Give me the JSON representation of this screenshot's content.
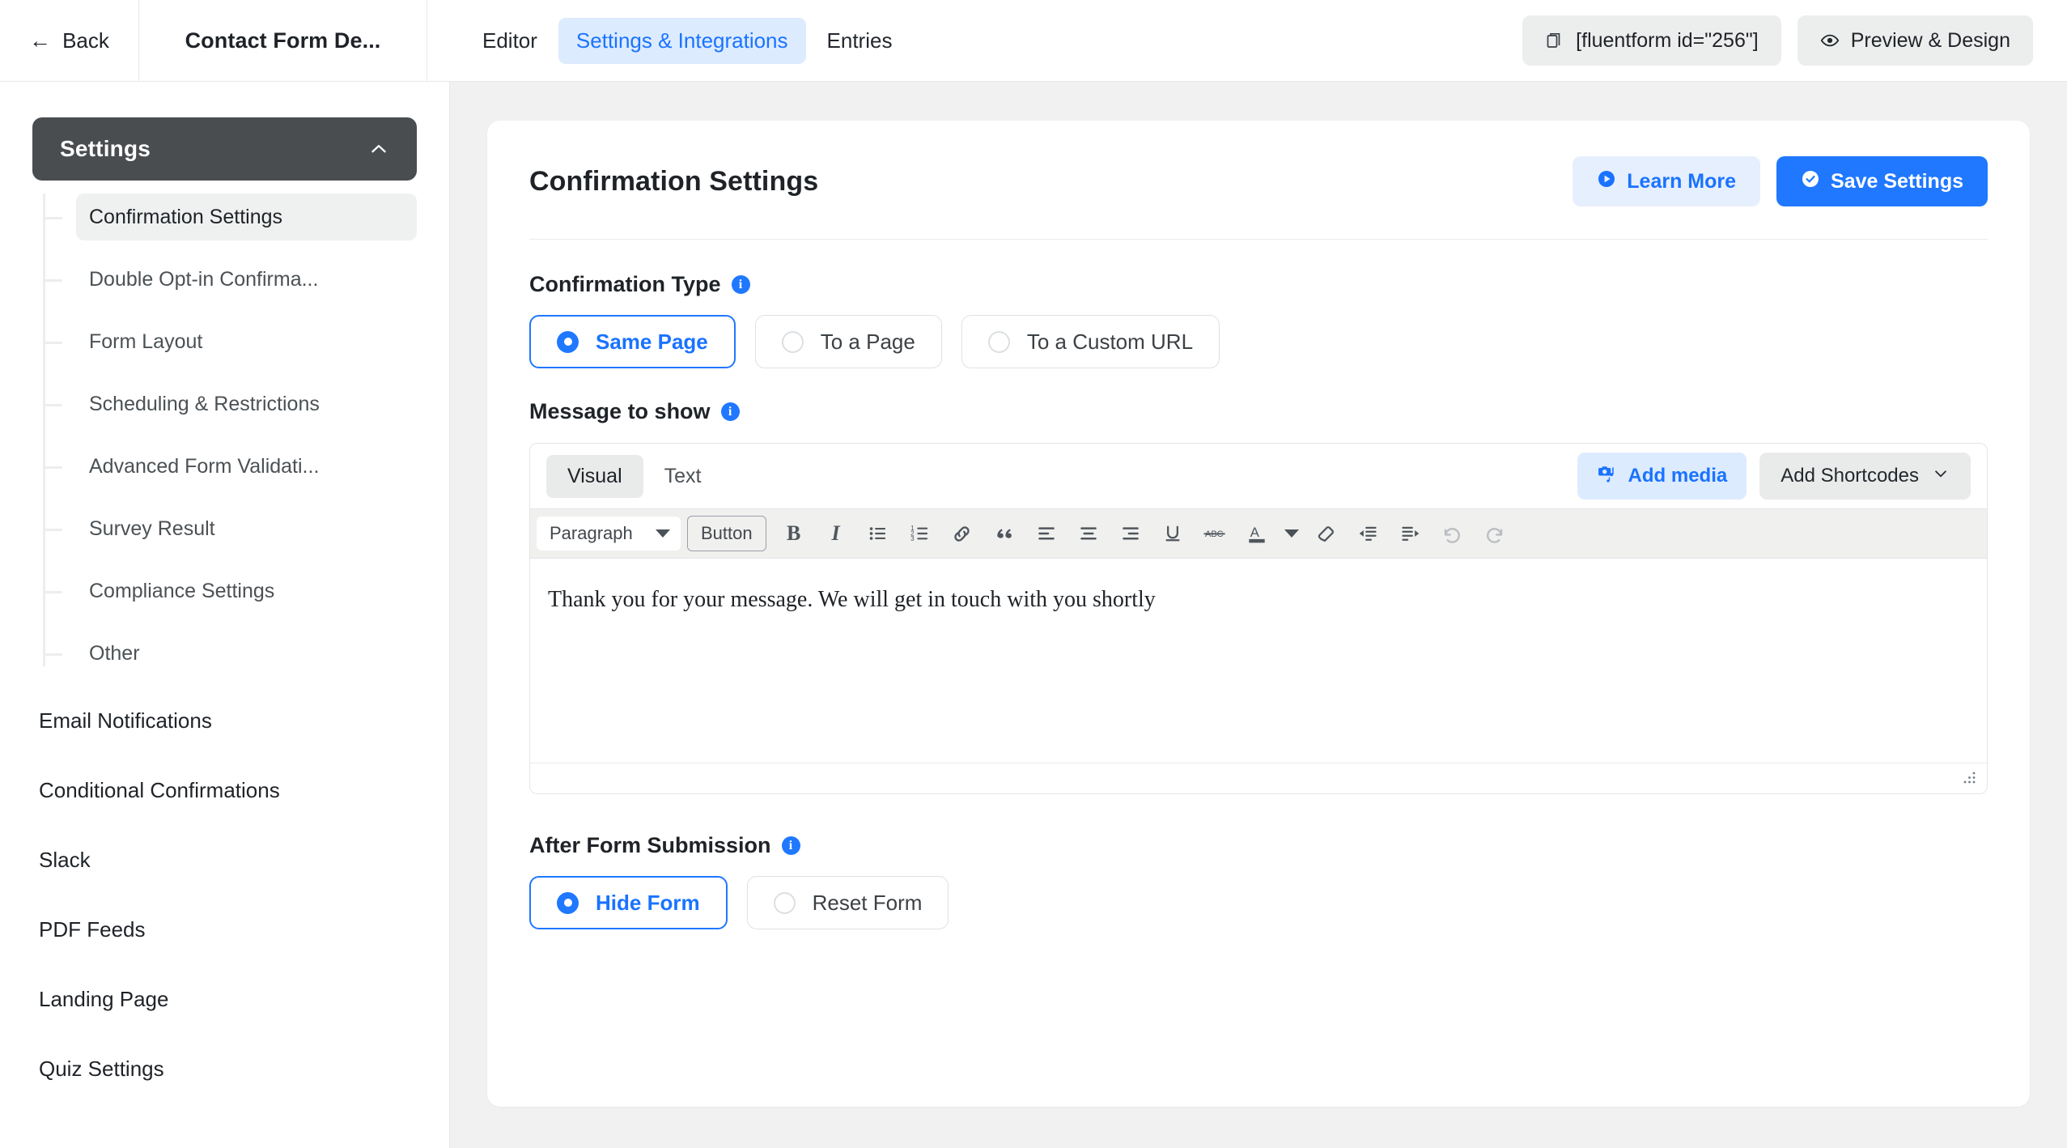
{
  "topbar": {
    "back_label": "Back",
    "back_icon": "arrow-left-icon",
    "form_title": "Contact Form De...",
    "tabs": [
      {
        "label": "Editor",
        "active": false
      },
      {
        "label": "Settings & Integrations",
        "active": true
      },
      {
        "label": "Entries",
        "active": false
      }
    ],
    "shortcode_button": {
      "label": "[fluentform id=\"256\"]",
      "icon": "copy-icon"
    },
    "preview_button": {
      "label": "Preview & Design",
      "icon": "eye-icon"
    }
  },
  "sidebar": {
    "section": {
      "label": "Settings",
      "icon": "chevron-up-icon",
      "expanded": true
    },
    "sub_items": [
      {
        "label": "Confirmation Settings",
        "active": true
      },
      {
        "label": "Double Opt-in Confirma...",
        "active": false
      },
      {
        "label": "Form Layout",
        "active": false
      },
      {
        "label": "Scheduling & Restrictions",
        "active": false
      },
      {
        "label": "Advanced Form Validati...",
        "active": false
      },
      {
        "label": "Survey Result",
        "active": false
      },
      {
        "label": "Compliance Settings",
        "active": false
      },
      {
        "label": "Other",
        "active": false
      }
    ],
    "top_items": [
      {
        "label": "Email Notifications"
      },
      {
        "label": "Conditional Confirmations"
      },
      {
        "label": "Slack"
      },
      {
        "label": "PDF Feeds"
      },
      {
        "label": "Landing Page"
      },
      {
        "label": "Quiz Settings"
      }
    ]
  },
  "main": {
    "card_title": "Confirmation Settings",
    "learn_more": {
      "label": "Learn More",
      "icon": "play-circle-icon"
    },
    "save_settings": {
      "label": "Save Settings",
      "icon": "check-circle-icon"
    },
    "confirmation_type": {
      "label": "Confirmation Type",
      "info_icon": "info-icon",
      "options": [
        {
          "label": "Same Page",
          "selected": true
        },
        {
          "label": "To a Page",
          "selected": false
        },
        {
          "label": "To a Custom URL",
          "selected": false
        }
      ]
    },
    "message_to_show": {
      "label": "Message to show",
      "info_icon": "info-icon",
      "editor_tabs": [
        {
          "label": "Visual",
          "active": true
        },
        {
          "label": "Text",
          "active": false
        }
      ],
      "add_media": {
        "label": "Add media",
        "icon": "add-media-icon"
      },
      "add_shortcodes": {
        "label": "Add Shortcodes",
        "icon": "chevron-down-icon"
      },
      "toolbar": {
        "format_select": {
          "value": "Paragraph",
          "icon": "caret-down-icon"
        },
        "button_chip": "Button",
        "icons": [
          "bold-icon",
          "italic-icon",
          "bulleted-list-icon",
          "numbered-list-icon",
          "link-icon",
          "blockquote-icon",
          "align-left-icon",
          "align-center-icon",
          "align-right-icon",
          "underline-icon",
          "strikethrough-icon",
          "text-color-icon",
          "text-color-dropdown-icon",
          "clear-formatting-icon",
          "outdent-icon",
          "indent-icon",
          "undo-icon",
          "redo-icon"
        ]
      },
      "content": "Thank you for your message. We will get in touch with you shortly",
      "resize_grip": "resize-grip-icon"
    },
    "after_form_submission": {
      "label": "After Form Submission",
      "info_icon": "info-icon",
      "options": [
        {
          "label": "Hide Form",
          "selected": true
        },
        {
          "label": "Reset Form",
          "selected": false
        }
      ]
    }
  },
  "colors": {
    "accent": "#1f78ff",
    "accent_light": "#ddebff",
    "sidebar_header": "#4a4d50",
    "page_bg": "#f1f1f1",
    "card_bg": "#ffffff",
    "toolbar_bg": "#f0f0ef"
  }
}
